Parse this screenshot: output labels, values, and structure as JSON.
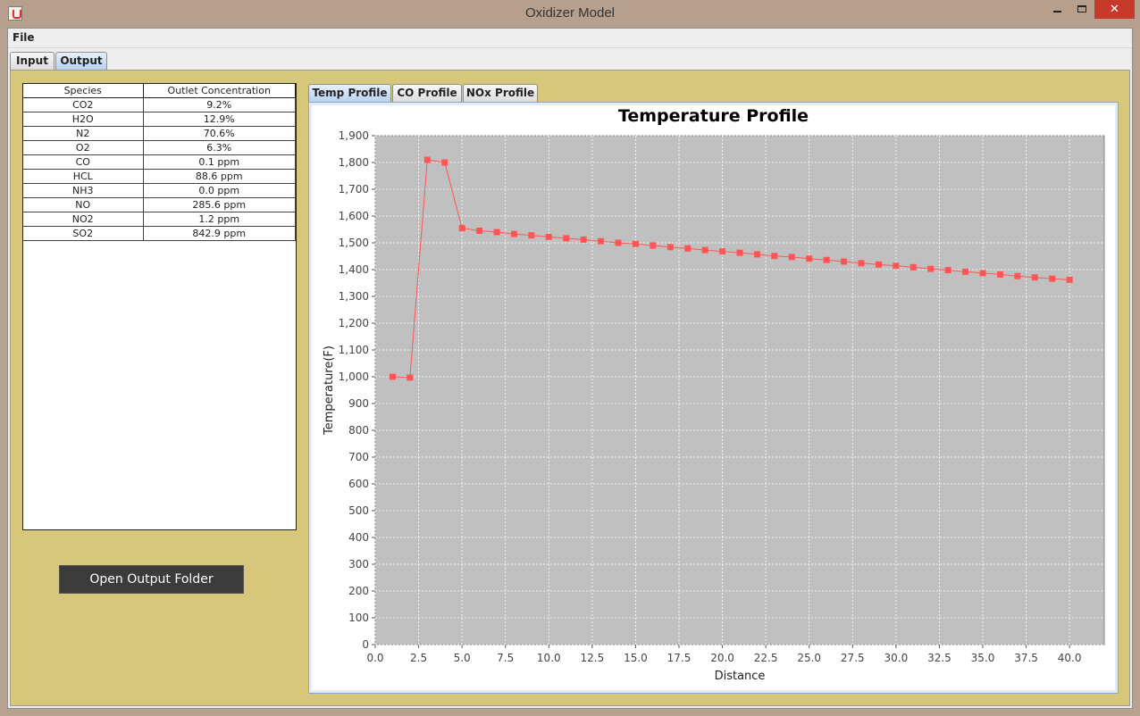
{
  "window": {
    "title": "Oxidizer Model"
  },
  "menu": {
    "file": "File"
  },
  "main_tabs": [
    {
      "label": "Input"
    },
    {
      "label": "Output"
    }
  ],
  "species_table": {
    "headers": [
      "Species",
      "Outlet Concentration"
    ],
    "rows": [
      [
        "CO2",
        "9.2%"
      ],
      [
        "H2O",
        "12.9%"
      ],
      [
        "N2",
        "70.6%"
      ],
      [
        "O2",
        "6.3%"
      ],
      [
        "CO",
        "0.1 ppm"
      ],
      [
        "HCL",
        "88.6 ppm"
      ],
      [
        "NH3",
        "0.0 ppm"
      ],
      [
        "NO",
        "285.6 ppm"
      ],
      [
        "NO2",
        "1.2 ppm"
      ],
      [
        "SO2",
        "842.9 ppm"
      ]
    ]
  },
  "open_output_button": "Open Output Folder",
  "profile_tabs": [
    {
      "label": "Temp Profile"
    },
    {
      "label": "CO Profile"
    },
    {
      "label": "NOx Profile"
    }
  ],
  "colors": {
    "series": "#ff5555",
    "plot_bg": "#c0c0c0",
    "panel_bg": "#d7c77b"
  },
  "chart_data": {
    "type": "line",
    "title": "Temperature Profile",
    "xlabel": "Distance",
    "ylabel": "Temperature(F)",
    "xlim": [
      0,
      42
    ],
    "ylim": [
      0,
      1900
    ],
    "xticks": [
      "0.0",
      "2.5",
      "5.0",
      "7.5",
      "10.0",
      "12.5",
      "15.0",
      "17.5",
      "20.0",
      "22.5",
      "25.0",
      "27.5",
      "30.0",
      "32.5",
      "35.0",
      "37.5",
      "40.0"
    ],
    "yticks": [
      "0",
      "100",
      "200",
      "300",
      "400",
      "500",
      "600",
      "700",
      "800",
      "900",
      "1,000",
      "1,100",
      "1,200",
      "1,300",
      "1,400",
      "1,500",
      "1,600",
      "1,700",
      "1,800",
      "1,900"
    ],
    "grid": true,
    "x": [
      1,
      2,
      3,
      4,
      5,
      6,
      7,
      8,
      9,
      10,
      11,
      12,
      13,
      14,
      15,
      16,
      17,
      18,
      19,
      20,
      21,
      22,
      23,
      24,
      25,
      26,
      27,
      28,
      29,
      30,
      31,
      32,
      33,
      34,
      35,
      36,
      37,
      38,
      39,
      40
    ],
    "y": [
      1000,
      997,
      1810,
      1800,
      1555,
      1545,
      1540,
      1533,
      1528,
      1522,
      1517,
      1512,
      1506,
      1500,
      1496,
      1490,
      1484,
      1479,
      1473,
      1468,
      1463,
      1457,
      1451,
      1447,
      1441,
      1436,
      1430,
      1424,
      1419,
      1414,
      1409,
      1403,
      1398,
      1392,
      1387,
      1382,
      1376,
      1371,
      1366,
      1362
    ]
  }
}
